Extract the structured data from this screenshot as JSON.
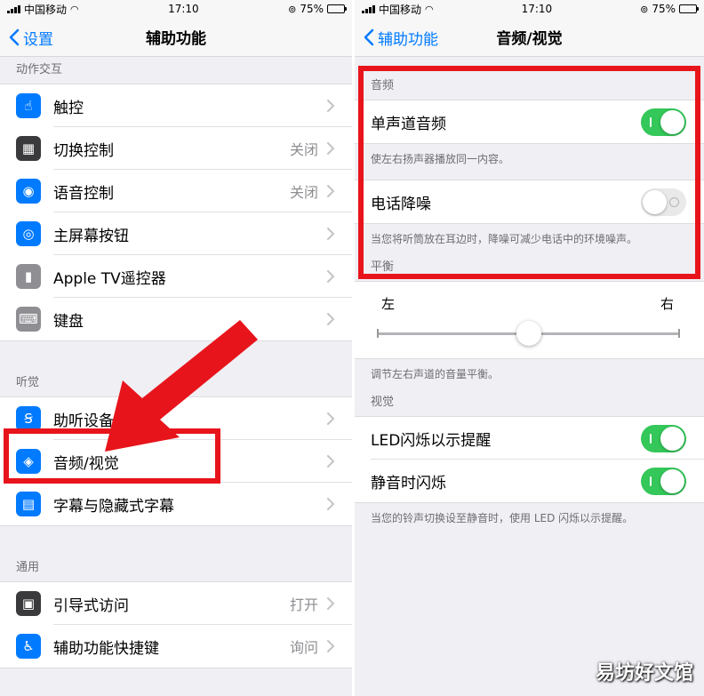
{
  "status_bar": {
    "carrier": "中国移动",
    "time": "17:10",
    "battery": "75%",
    "battery_level": 0.75
  },
  "left_screen": {
    "back_label": "设置",
    "title": "辅助功能",
    "sections": [
      {
        "header": "动作交互",
        "items": [
          {
            "label": "触控",
            "value": "",
            "icon": "hand-touch-icon",
            "color": "#007aff"
          },
          {
            "label": "切换控制",
            "value": "关闭",
            "icon": "grid-switch-icon",
            "color": "#3a3a3c"
          },
          {
            "label": "语音控制",
            "value": "关闭",
            "icon": "voice-control-icon",
            "color": "#007aff"
          },
          {
            "label": "主屏幕按钮",
            "value": "",
            "icon": "home-button-icon",
            "color": "#007aff"
          },
          {
            "label": "Apple TV遥控器",
            "value": "",
            "icon": "remote-icon",
            "color": "#8e8e93"
          },
          {
            "label": "键盘",
            "value": "",
            "icon": "keyboard-icon",
            "color": "#8e8e93"
          }
        ]
      },
      {
        "header": "听觉",
        "items": [
          {
            "label": "助听设备",
            "value": "",
            "icon": "ear-icon",
            "color": "#007aff"
          },
          {
            "label": "音频/视觉",
            "value": "",
            "icon": "audio-visual-icon",
            "color": "#007aff"
          },
          {
            "label": "字幕与隐藏式字幕",
            "value": "",
            "icon": "captions-icon",
            "color": "#007aff"
          }
        ]
      },
      {
        "header": "通用",
        "items": [
          {
            "label": "引导式访问",
            "value": "打开",
            "icon": "lock-icon",
            "color": "#3a3a3c"
          },
          {
            "label": "辅助功能快捷键",
            "value": "询问",
            "icon": "accessibility-icon",
            "color": "#007aff"
          }
        ]
      }
    ]
  },
  "right_screen": {
    "back_label": "辅助功能",
    "title": "音频/视觉",
    "audio": {
      "header": "音频",
      "mono_label": "单声道音频",
      "mono_on": true,
      "mono_note": "使左右扬声器播放同一内容。",
      "noise_label": "电话降噪",
      "noise_on": false,
      "noise_note": "当您将听筒放在耳边时，降噪可减少电话中的环境噪声。"
    },
    "balance": {
      "header": "平衡",
      "left_label": "左",
      "right_label": "右",
      "value": 0.5,
      "note": "调节左右声道的音量平衡。"
    },
    "visual": {
      "header": "视觉",
      "led_label": "LED闪烁以示提醒",
      "led_on": true,
      "silent_label": "静音时闪烁",
      "silent_on": true,
      "note": "当您的铃声切换设至静音时，使用 LED 闪烁以示提醒。"
    }
  },
  "watermark": "易坊好文馆",
  "colors": {
    "accent": "#007aff",
    "toggle_on": "#34c759",
    "highlight": "#e8141b"
  }
}
